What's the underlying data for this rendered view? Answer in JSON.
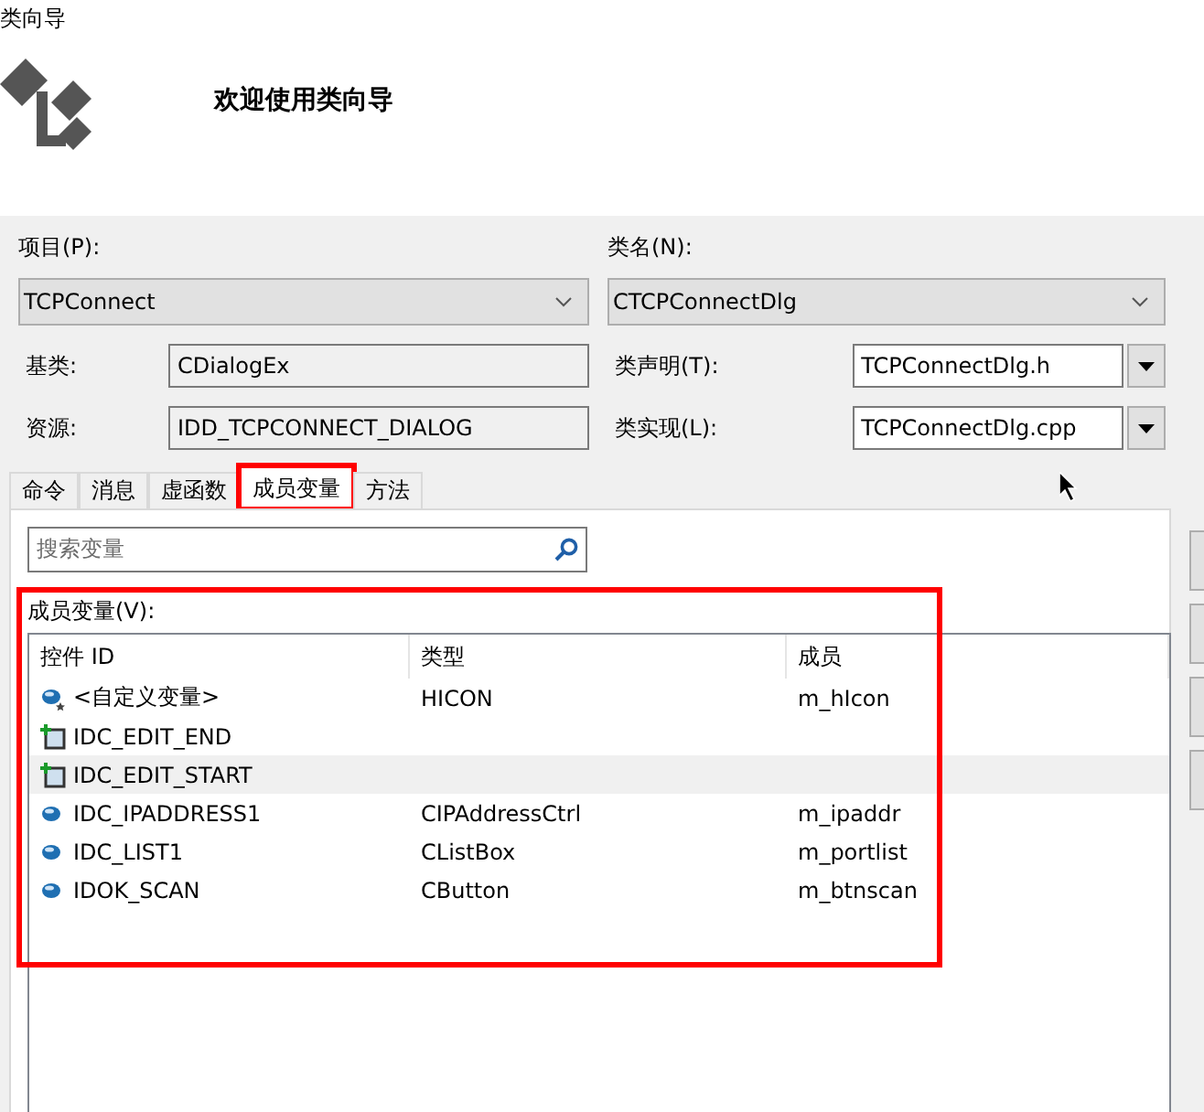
{
  "window": {
    "title": "类向导"
  },
  "header": {
    "welcome": "欢迎使用类向导"
  },
  "project": {
    "label": "项目(P):",
    "value": "TCPConnect"
  },
  "class_name": {
    "label": "类名(N):",
    "value": "CTCPConnectDlg"
  },
  "base_class": {
    "label": "基类:",
    "value": "CDialogEx"
  },
  "resource": {
    "label": "资源:",
    "value": "IDD_TCPCONNECT_DIALOG"
  },
  "class_header": {
    "label": "类声明(T):",
    "value": "TCPConnectDlg.h"
  },
  "class_impl": {
    "label": "类实现(L):",
    "value": "TCPConnectDlg.cpp"
  },
  "tabs": [
    {
      "label": "命令",
      "selected": false,
      "highlighted": false
    },
    {
      "label": "消息",
      "selected": false,
      "highlighted": false
    },
    {
      "label": "虚函数",
      "selected": false,
      "highlighted": false
    },
    {
      "label": "成员变量",
      "selected": true,
      "highlighted": true
    },
    {
      "label": "方法",
      "selected": false,
      "highlighted": false
    }
  ],
  "search": {
    "placeholder": "搜索变量"
  },
  "members": {
    "label": "成员变量(V):",
    "highlighted": true,
    "columns": [
      "控件 ID",
      "类型",
      "成员"
    ],
    "rows": [
      {
        "kind": "custom",
        "id": "<自定义变量>",
        "type": "HICON",
        "member": "m_hIcon",
        "selected": false
      },
      {
        "kind": "edit",
        "id": "IDC_EDIT_END",
        "selected": false
      },
      {
        "kind": "edit",
        "id": "IDC_EDIT_START",
        "selected": true
      },
      {
        "kind": "member",
        "id": "IDC_IPADDRESS1",
        "type": "CIPAddressCtrl",
        "member": "m_ipaddr",
        "selected": false
      },
      {
        "kind": "member",
        "id": "IDC_LIST1",
        "type": "CListBox",
        "member": "m_portlist",
        "selected": false
      },
      {
        "kind": "member",
        "id": "IDOK_SCAN",
        "type": "CButton",
        "member": "m_btnscan",
        "selected": false
      }
    ]
  }
}
